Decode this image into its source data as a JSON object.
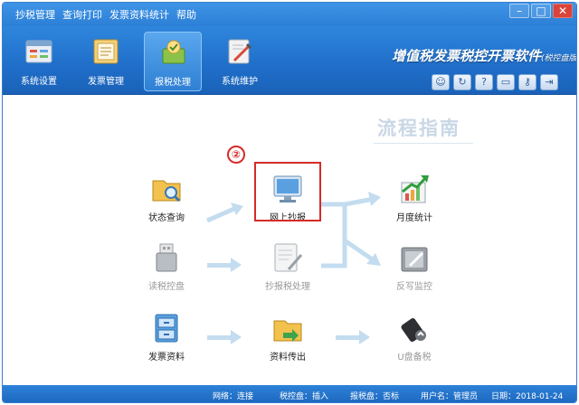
{
  "menu": {
    "items": [
      "抄税管理",
      "查询打印",
      "发票资料统计",
      "帮助"
    ]
  },
  "window_controls": [
    "–",
    "□",
    "✕"
  ],
  "toolbar": {
    "tools": [
      {
        "label": "系统设置",
        "icon": "settings-panel-icon"
      },
      {
        "label": "发票管理",
        "icon": "invoice-book-icon"
      },
      {
        "label": "报税处理",
        "icon": "tax-report-icon"
      },
      {
        "label": "系统维护",
        "icon": "maintenance-tools-icon"
      }
    ],
    "active_index": 2,
    "brand_title": "增值税发票税控开票软件",
    "brand_sub": "(税控盘版)",
    "quick_buttons": [
      "user-icon",
      "refresh-icon",
      "help-icon",
      "window-icon",
      "key-icon",
      "exit-icon"
    ]
  },
  "guide": {
    "title": "流程指南",
    "step_number": "②",
    "nodes": [
      {
        "label": "状态查询",
        "icon": "status-query-folder-icon",
        "enabled": true
      },
      {
        "label": "网上抄报",
        "icon": "online-report-monitor-icon",
        "enabled": true,
        "highlighted": true
      },
      {
        "label": "月度统计",
        "icon": "monthly-stats-chart-icon",
        "enabled": true
      },
      {
        "label": "读税控盘",
        "icon": "read-usb-key-icon",
        "enabled": false
      },
      {
        "label": "抄报税处理",
        "icon": "report-process-icon",
        "enabled": false
      },
      {
        "label": "反写监控",
        "icon": "writeback-monitor-icon",
        "enabled": false
      },
      {
        "label": "发票资料",
        "icon": "invoice-data-cabinet-icon",
        "enabled": true
      },
      {
        "label": "资料传出",
        "icon": "data-export-folder-icon",
        "enabled": true
      },
      {
        "label": "U盘备税",
        "icon": "usb-backup-icon",
        "enabled": false
      }
    ]
  },
  "status": {
    "network": "网络：连接",
    "tax_disk": "税控盘：插入",
    "report_disk": "报税盘：否标",
    "user": "用户名：管理员",
    "date": "日期：2018-01-24"
  },
  "colors": {
    "title_blue": "#2c7fd6",
    "highlight_red": "#d62a2a",
    "arrow_light_blue": "#c3dcef"
  }
}
